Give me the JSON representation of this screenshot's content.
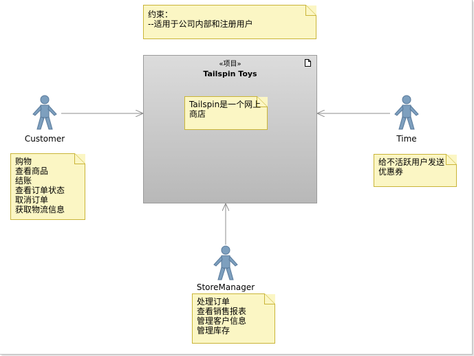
{
  "constraint_note": {
    "lines": [
      "约束：",
      "--适用于公司内部和注册用户"
    ]
  },
  "project": {
    "stereotype": "«项目»",
    "title": "Tailspin Toys",
    "icon": "document-icon"
  },
  "project_note": {
    "lines": [
      "Tailspin是一个网上",
      "商店"
    ]
  },
  "actors": {
    "customer": {
      "name": "Customer",
      "icon": "actor-icon"
    },
    "time": {
      "name": "Time",
      "icon": "actor-icon"
    },
    "store_manager": {
      "name": "StoreManager",
      "icon": "actor-icon"
    }
  },
  "customer_note": {
    "lines": [
      "购物",
      "查看商品",
      "结账",
      "查看订单状态",
      "取消订单",
      "获取物流信息"
    ]
  },
  "time_note": {
    "lines": [
      "给不活跃用户发送",
      "优惠券"
    ]
  },
  "manager_note": {
    "lines": [
      "处理订单",
      "查看销售报表",
      "管理客户信息",
      "管理库存"
    ]
  },
  "colors": {
    "note_fill": "#fbf6c4",
    "note_border": "#c9b437",
    "actor_fill": "#7d9fbe",
    "actor_stroke": "#58799a",
    "connector": "#8c8c8c"
  }
}
